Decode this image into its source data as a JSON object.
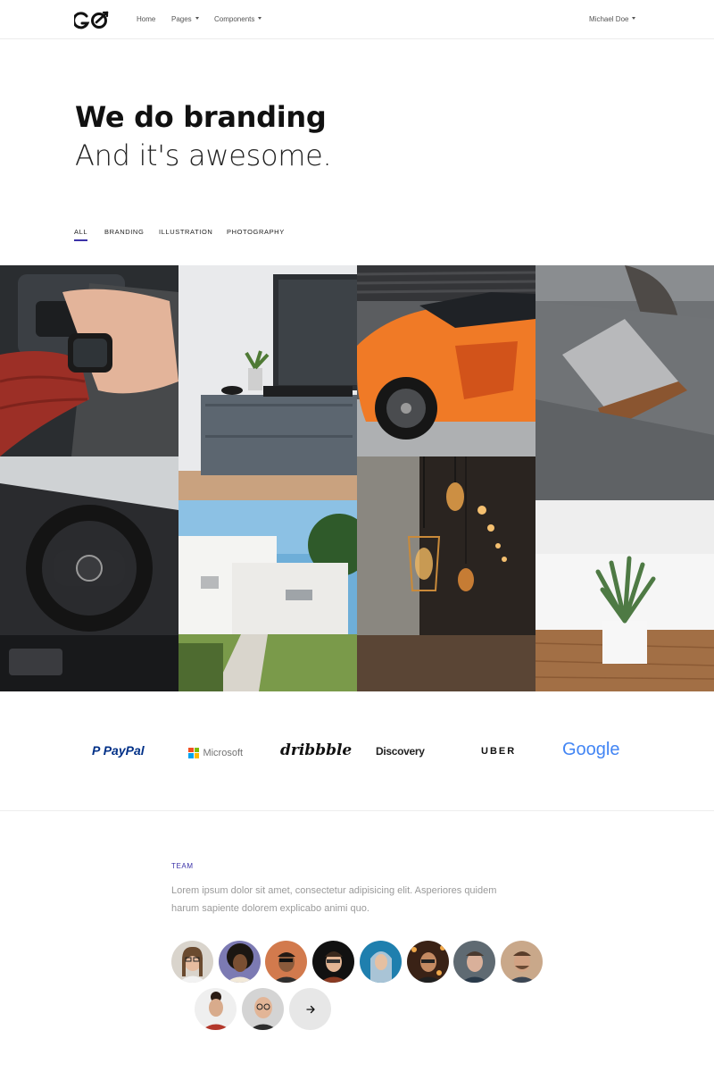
{
  "nav": {
    "logo_text": "GO",
    "links": [
      {
        "label": "Home"
      },
      {
        "label": "Pages"
      },
      {
        "label": "Components"
      }
    ],
    "user": "Michael Doe"
  },
  "hero": {
    "title": "We do branding",
    "subtitle": "And it's awesome."
  },
  "filters": [
    {
      "label": "ALL",
      "active": true
    },
    {
      "label": "BRANDING",
      "active": false
    },
    {
      "label": "ILLUSTRATION",
      "active": false
    },
    {
      "label": "PHOTOGRAPHY",
      "active": false
    }
  ],
  "gallery": [
    {
      "subject": "smartwatch-on-wrist"
    },
    {
      "subject": "car-steering-wheel"
    },
    {
      "subject": "tv-on-console"
    },
    {
      "subject": "white-house"
    },
    {
      "subject": "orange-sports-car"
    },
    {
      "subject": "hanging-edison-lamps"
    },
    {
      "subject": "laptop-on-sofa"
    },
    {
      "subject": "potted-plant-on-floor"
    }
  ],
  "brands": [
    "PayPal",
    "Microsoft",
    "dribbble",
    "Discovery",
    "UBER",
    "Google"
  ],
  "team": {
    "label": "TEAM",
    "description": "Lorem ipsum dolor sit amet, consectetur adipisicing elit. Asperiores quidem harum sapiente dolorem explicabo animi quo.",
    "more_icon": "arrow-right-icon"
  },
  "colors": {
    "accent": "#3b32a8",
    "paypal_dark": "#003087",
    "paypal_light": "#009cde"
  }
}
